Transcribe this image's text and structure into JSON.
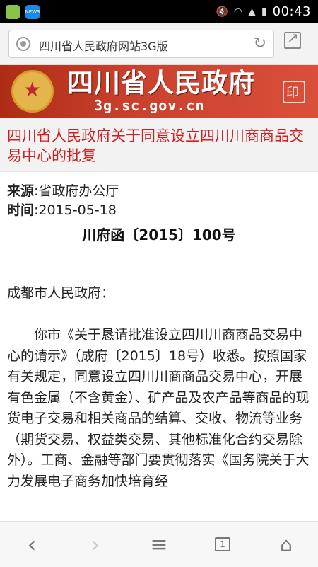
{
  "status_bar": {
    "time": "00:43",
    "app_icon_1": "green-circle-app-icon",
    "app_icon_2_label": "NEWS",
    "icons": [
      "mute-icon",
      "wifi-icon",
      "network-icon",
      "signal-icon",
      "battery-icon"
    ]
  },
  "address_bar": {
    "title": "四川省人民政府网站3G版",
    "refresh_icon": "refresh-icon",
    "share_icon": "share-icon"
  },
  "banner": {
    "title": "四川省人民政府",
    "domain": "3g.sc.gov.cn"
  },
  "article": {
    "headline": "四川省人民政府关于同意设立四川川商商品交易中心的批复",
    "source_label": "来源",
    "source_value": ":省政府办公厅",
    "time_label": "时间",
    "time_value": ":2015-05-18",
    "doc_number": "川府函〔2015〕100号",
    "salutation": "成都市人民政府：",
    "body": "你市《关于恳请批准设立四川川商商品交易中心的请示》（成府〔2015〕18号）收悉。按照国家有关规定，同意设立四川川商商品交易中心，开展有色金属（不含黄金）、矿产品及农产品等商品的现货电子交易和相关商品的结算、交收、物流等业务（期货交易、权益类交易、其他标准化合约交易除外）。工商、金融等部门要贯彻落实《国务院关于大力发展电子商务加快培育经"
  },
  "bottom_nav": {
    "tabs_count": "1"
  },
  "colors": {
    "headline_red": "#d21e1e",
    "banner_red": "#c9402d"
  }
}
